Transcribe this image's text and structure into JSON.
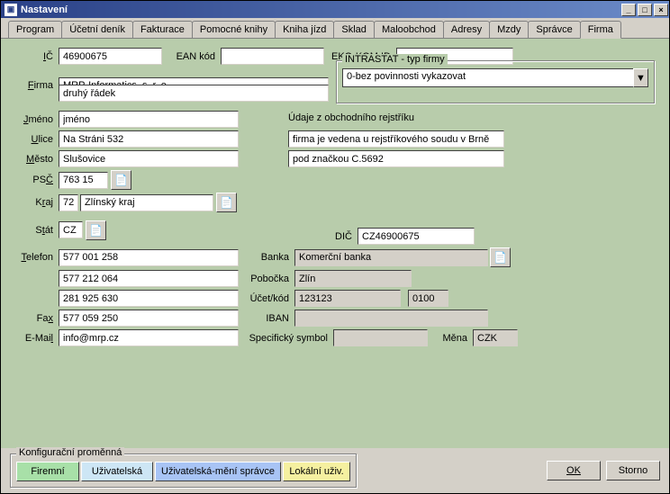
{
  "window": {
    "title": "Nastavení"
  },
  "tabs": [
    "Program",
    "Účetní deník",
    "Fakturace",
    "Pomocné knihy",
    "Kniha jízd",
    "Sklad",
    "Maloobchod",
    "Adresy",
    "Mzdy",
    "Správce",
    "Firma"
  ],
  "labels": {
    "ic": "IČ",
    "ean": "EAN kód",
    "ekokom": "EKO-KOM ID",
    "firma": "Firma",
    "intrastat": "INTRASTAT - typ firmy",
    "jmeno": "Jméno",
    "obch": "Údaje z obchodního rejstříku",
    "ulice": "Ulice",
    "mesto": "Město",
    "psc": "PSČ",
    "kraj": "Kraj",
    "stat": "Stát",
    "dic": "DIČ",
    "telefon": "Telefon",
    "banka": "Banka",
    "pobocka": "Pobočka",
    "ucet": "Účet/kód",
    "iban": "IBAN",
    "fax": "Fax",
    "email": "E-Mail",
    "specsym": "Specifický symbol",
    "mena": "Měna"
  },
  "values": {
    "ic": "46900675",
    "ean": "",
    "ekokom": "",
    "firma1": "MRP-Informatics, s. r. o.",
    "firma2": "druhý řádek",
    "intrastat": "0-bez povinnosti vykazovat",
    "jmeno": "jméno",
    "obch1": "firma je vedena u rejstříkového soudu v Brně",
    "obch2": "pod značkou C.5692",
    "ulice": "Na Stráni 532",
    "mesto": "Slušovice",
    "psc": "763 15",
    "kraj_kod": "72",
    "kraj": "Zlínský kraj",
    "stat": "CZ",
    "dic": "CZ46900675",
    "tel1": "577 001 258",
    "tel2": "577 212 064",
    "tel3": "281 925 630",
    "banka": "Komerční banka",
    "pobocka": "Zlín",
    "ucet": "123123",
    "ucet_kod": "0100",
    "iban": "",
    "fax": "577 059 250",
    "email": "info@mrp.cz",
    "specsym": "",
    "mena": "CZK"
  },
  "bottom": {
    "group": "Konfigurační proměnná",
    "btn1": "Firemní",
    "btn2": "Uživatelská",
    "btn3": "Uživatelská-mění správce",
    "btn4": "Lokální uživ.",
    "ok": "OK",
    "storno": "Storno"
  },
  "colors": {
    "btn1": "#a8e0a8",
    "btn2": "#cde6f5",
    "btn3": "#a8c4f5",
    "btn4": "#f5f0a0"
  }
}
